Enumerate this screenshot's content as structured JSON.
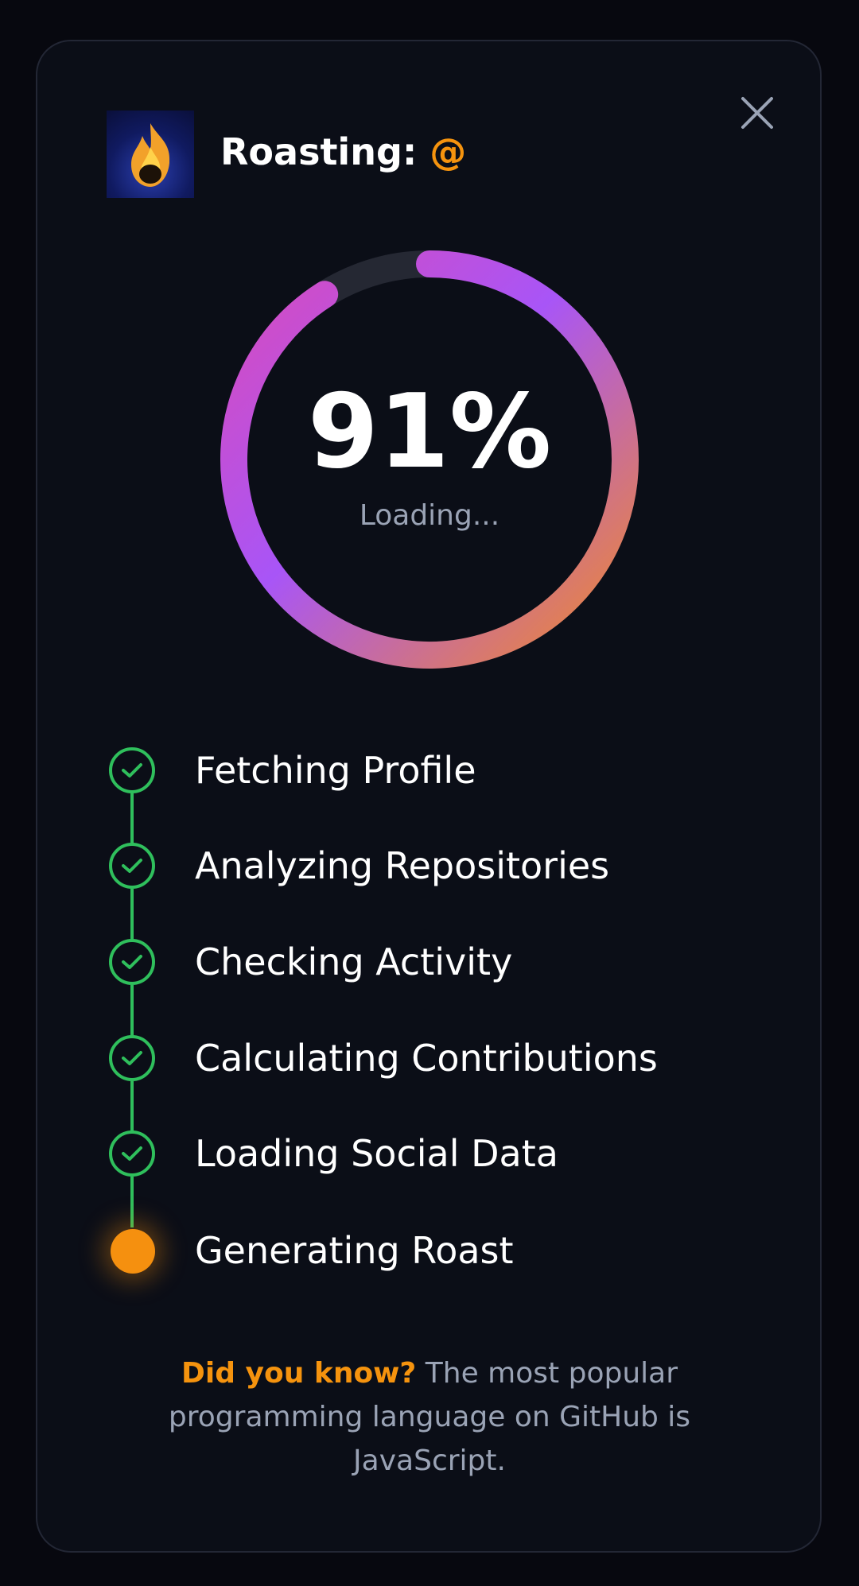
{
  "modal": {
    "title_prefix": "Roasting:",
    "handle": "@",
    "close_icon": "close-icon",
    "avatar_icon": "fire-icon"
  },
  "progress": {
    "percent": 91,
    "percent_label": "91%",
    "status": "Loading..."
  },
  "steps": [
    {
      "label": "Fetching Profile",
      "state": "done"
    },
    {
      "label": "Analyzing Repositories",
      "state": "done"
    },
    {
      "label": "Checking Activity",
      "state": "done"
    },
    {
      "label": "Calculating Contributions",
      "state": "done"
    },
    {
      "label": "Loading Social Data",
      "state": "done"
    },
    {
      "label": "Generating Roast",
      "state": "active"
    }
  ],
  "fact": {
    "lead": "Did you know?",
    "text": "The most popular programming language on GitHub is JavaScript."
  },
  "colors": {
    "accent": "#f5930e",
    "success": "#2fbf5c",
    "ring_start": "#ef8a2c",
    "ring_mid": "#a855f7",
    "ring_end": "#d94bbb",
    "track": "#252833"
  }
}
